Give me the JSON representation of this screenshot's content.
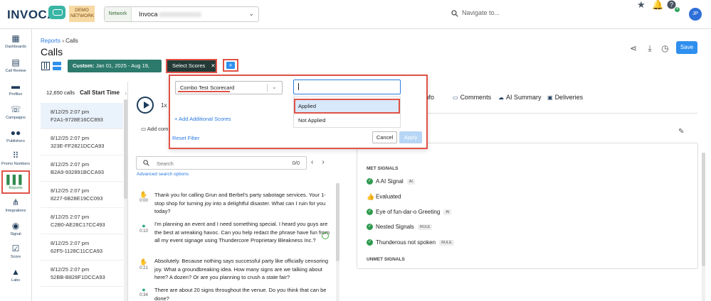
{
  "brand": {
    "logo_text": "INVOCA",
    "badge": "DEMO NETWORK"
  },
  "network": {
    "label": "Network",
    "value": "Invoca"
  },
  "search": {
    "placeholder": "Navigate to..."
  },
  "user": {
    "initials": "JP",
    "help_badge_count": "4"
  },
  "sidebar": {
    "items": [
      {
        "label": "Dashboards",
        "icon": "dashboard-icon"
      },
      {
        "label": "Call Review",
        "icon": "call-review-icon"
      },
      {
        "label": "Profiles",
        "icon": "profiles-icon"
      },
      {
        "label": "Campaigns",
        "icon": "campaigns-icon"
      },
      {
        "label": "Publishers",
        "icon": "publishers-icon"
      },
      {
        "label": "Promo Numbers",
        "icon": "promo-numbers-icon"
      },
      {
        "label": "Reports",
        "icon": "reports-icon"
      },
      {
        "label": "Integrations",
        "icon": "integrations-icon"
      },
      {
        "label": "Signal",
        "icon": "signal-icon"
      },
      {
        "label": "Score",
        "icon": "score-icon"
      },
      {
        "label": "Labs",
        "icon": "labs-icon"
      }
    ]
  },
  "header": {
    "breadcrumb_root": "Reports",
    "breadcrumb_current": "Calls",
    "title": "Calls",
    "save_label": "Save"
  },
  "filters": {
    "date_prefix": "Custom:",
    "date_range": "Jan 01, 2025 - Aug 19, 2025",
    "score_chip": "Select Scores",
    "score_chip_close": "✕",
    "plus": "+"
  },
  "calls": {
    "count": "12,650 calls",
    "sort_label": "Call Start Time",
    "sort_arrow": "↓",
    "rows": [
      {
        "time": "8/12/25 2:07 pm",
        "id": "F2A1-9728E16CC893"
      },
      {
        "time": "8/12/25 2:07 pm",
        "id": "323E-FF2821DCCA93"
      },
      {
        "time": "8/12/25 2:07 pm",
        "id": "B2A9-932891BCCA93"
      },
      {
        "time": "8/12/25 2:07 pm",
        "id": "8227-6B28E19CC093"
      },
      {
        "time": "8/12/25 2:07 pm",
        "id": "C2B0-AE28C17CC493"
      },
      {
        "time": "8/12/25 2:07 pm",
        "id": "62F5-1128C11CCA93"
      },
      {
        "time": "8/12/25 2:07 pm",
        "id": "52BB-B828F1DCCA93"
      }
    ]
  },
  "player": {
    "speed": "1x",
    "add_comment": "Add com"
  },
  "transcript": {
    "search_placeholder": "Search",
    "search_count": "0/0",
    "advanced_link": "Advanced search options",
    "messages": [
      {
        "speaker": "caller",
        "time": "0:00",
        "text": "Thank you for calling Grun and Berbel's party sabotage services. Your 1-stop shop for turning joy into a delightful disaster. What can I ruin for you today?"
      },
      {
        "speaker": "agent",
        "time": "0:10",
        "text": "I'm planning an event and I need something special. I heard you guys are the best at wreaking havoc. Can you help redact the phrase have fun from all my event signage using Thundercore Proprietary Bleakness Inc.?"
      },
      {
        "speaker": "caller",
        "time": "0:21",
        "text": "Absolutely. Because nothing says successful party like officially censoring joy. What a groundbreaking idea. How many signs are we talking about here? A dozen? Or are you planning to crush a state fair?"
      },
      {
        "speaker": "agent",
        "time": "0:34",
        "text": "There are about 20 signs throughout the venue. Do you think that can be done?"
      }
    ]
  },
  "right_panel": {
    "tabs": [
      {
        "label": "Info",
        "icon": "info-icon"
      },
      {
        "label": "Comments",
        "icon": "comments-icon"
      },
      {
        "label": "AI Summary",
        "icon": "ai-summary-icon"
      },
      {
        "label": "Deliveries",
        "icon": "deliveries-icon"
      }
    ],
    "met_heading": "MET SIGNALS",
    "unmet_heading": "UNMET SIGNALS",
    "met_signals": [
      {
        "name": "A AI Signal",
        "tag": "AI",
        "icon": "check-icon"
      },
      {
        "name": "Evaluated",
        "tag": "",
        "icon": "thumbs-up-icon"
      },
      {
        "name": "Eye of fun-dar-o Greeting",
        "tag": "AI",
        "icon": "check-icon"
      },
      {
        "name": "Nested Signals",
        "tag": "RULE",
        "icon": "check-icon"
      },
      {
        "name": "Thunderous not spoken",
        "tag": "RULE",
        "icon": "check-icon"
      }
    ]
  },
  "popup": {
    "scorecard_value": "Combo Test Scorecard",
    "add_scores": "+ Add Additional Scores",
    "reset": "Reset Filter",
    "cancel": "Cancel",
    "apply": "Apply",
    "filter_value": "",
    "options": [
      "Applied",
      "Not Applied"
    ]
  },
  "colors": {
    "accent": "#2e8fee",
    "highlight": "#e05247",
    "teal": "#2b7a6b",
    "success": "#2e9a4f"
  }
}
